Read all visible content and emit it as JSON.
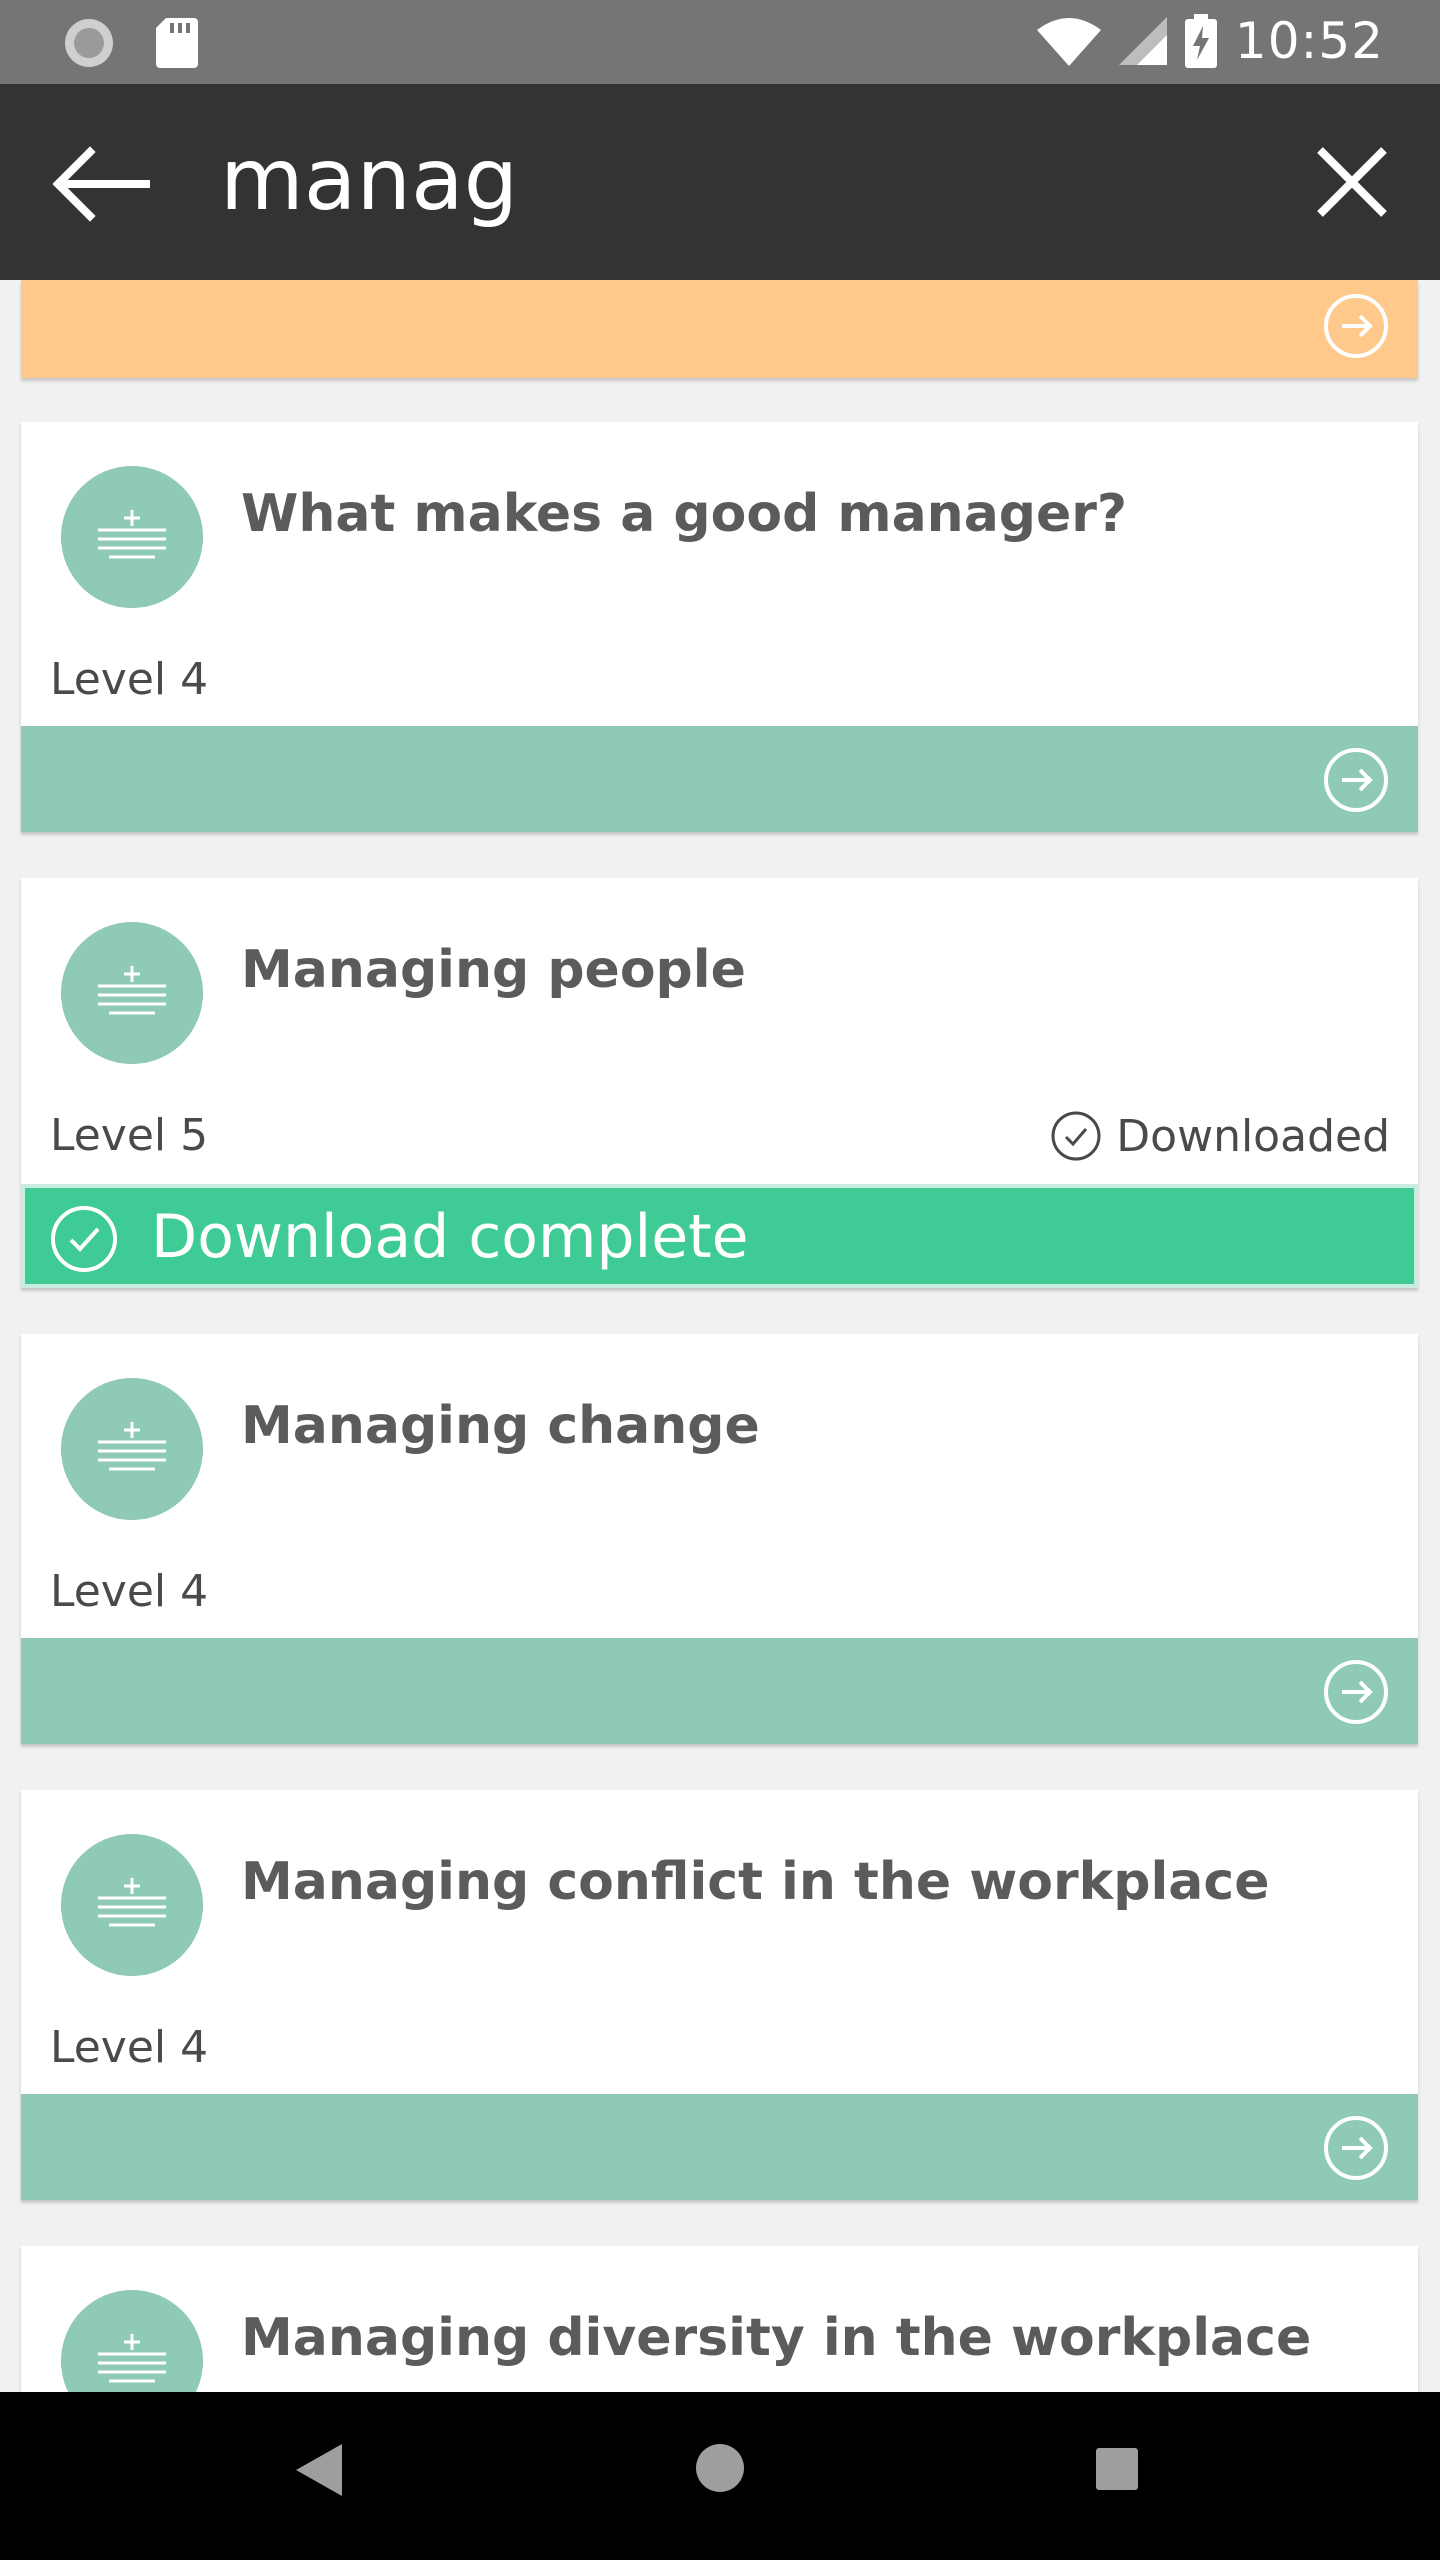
{
  "status_bar": {
    "time": "10:52"
  },
  "app_bar": {
    "query": "manag"
  },
  "results": [
    {
      "title": "What makes a good manager?",
      "level": "Level 4"
    },
    {
      "title": "Managing people",
      "level": "Level 5",
      "status": "Downloaded",
      "banner": "Download complete"
    },
    {
      "title": "Managing change",
      "level": "Level 4"
    },
    {
      "title": "Managing conflict in the workplace",
      "level": "Level 4"
    },
    {
      "title": "Managing diversity in the workplace"
    }
  ],
  "colors": {
    "accent_green": "#8ecab6",
    "complete_green": "#3ecb96",
    "orange": "#fec98a",
    "appbar": "#333333"
  }
}
